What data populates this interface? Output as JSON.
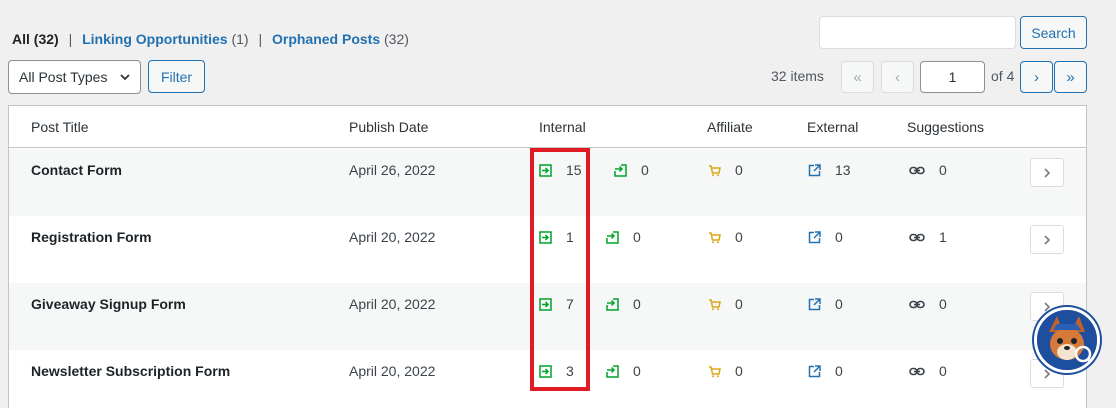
{
  "filters": {
    "all_label": "All",
    "all_count": "(32)",
    "sep": "|",
    "linking_label": "Linking Opportunities",
    "linking_count": "(1)",
    "orphaned_label": "Orphaned Posts",
    "orphaned_count": "(32)"
  },
  "search": {
    "value": "",
    "button_label": "Search"
  },
  "post_type_select": {
    "selected": "All Post Types"
  },
  "filter_button_label": "Filter",
  "pagination": {
    "items_count": "32 items",
    "first": "«",
    "prev": "‹",
    "current_page": "1",
    "of_total": "of 4",
    "next": "›",
    "last": "»"
  },
  "table": {
    "headers": {
      "title": "Post Title",
      "date": "Publish Date",
      "internal": "Internal",
      "affiliate": "Affiliate",
      "external": "External",
      "suggestions": "Suggestions"
    },
    "rows": [
      {
        "title": "Contact Form",
        "date": "April 26, 2022",
        "internal_in": "15",
        "internal_out": "0",
        "affiliate": "0",
        "external": "13",
        "suggestions": "0"
      },
      {
        "title": "Registration Form",
        "date": "April 20, 2022",
        "internal_in": "1",
        "internal_out": "0",
        "affiliate": "0",
        "external": "0",
        "suggestions": "1"
      },
      {
        "title": "Giveaway Signup Form",
        "date": "April 20, 2022",
        "internal_in": "7",
        "internal_out": "0",
        "affiliate": "0",
        "external": "0",
        "suggestions": "0"
      },
      {
        "title": "Newsletter Subscription Form",
        "date": "April 20, 2022",
        "internal_in": "3",
        "internal_out": "0",
        "affiliate": "0",
        "external": "0",
        "suggestions": "0"
      }
    ]
  },
  "colors": {
    "link_blue": "#2271b1",
    "internal_green": "#00a32a",
    "affiliate_orange": "#dba617",
    "external_blue": "#2271b1",
    "highlight_red": "#e01b24"
  }
}
